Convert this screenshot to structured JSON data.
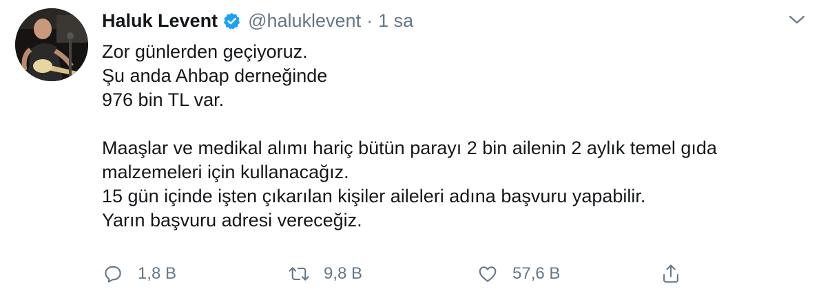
{
  "tweet": {
    "display_name": "Haluk Levent",
    "handle": "@haluklevent",
    "separator": "·",
    "time": "1 sa",
    "verified": true,
    "lines": [
      "Zor günlerden geçiyoruz.",
      "Şu anda Ahbap derneğinde",
      "976 bin TL var.",
      "",
      "Maaşlar ve medikal alımı hariç bütün parayı 2 bin ailenin 2 aylık temel gıda",
      "malzemeleri için kullanacağız.",
      "15 gün içinde işten çıkarılan kişiler aileleri adına başvuru yapabilir.",
      "Yarın başvuru adresi vereceğiz."
    ],
    "actions": {
      "reply_count": "1,8 B",
      "retweet_count": "9,8 B",
      "like_count": "57,6 B"
    }
  },
  "icons": {
    "verified": "verified-badge-icon",
    "caret": "chevron-down-icon",
    "reply": "reply-icon",
    "retweet": "retweet-icon",
    "like": "heart-icon",
    "share": "share-icon"
  },
  "colors": {
    "text": "#14171a",
    "secondary": "#657786",
    "verified_blue": "#1da1f2",
    "background": "#ffffff"
  }
}
